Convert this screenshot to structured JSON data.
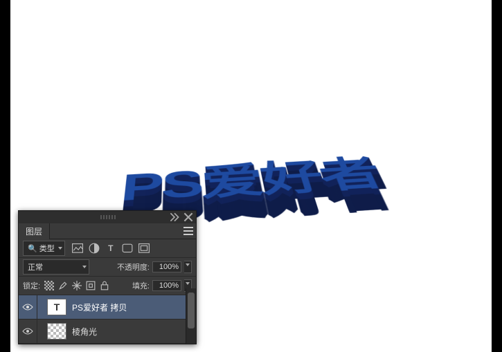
{
  "canvas": {
    "artwork_text": "PS爱好者"
  },
  "panel": {
    "tab_label": "图层",
    "filter_label": "类型",
    "filter_prefix": "🔍",
    "blend_mode": "正常",
    "opacity_label": "不透明度:",
    "opacity_value": "100%",
    "lock_label": "锁定:",
    "fill_label": "填充:",
    "fill_value": "100%",
    "filter_icons": {
      "image": "image-filter-icon",
      "adjust": "adjust-filter-icon",
      "type": "type-filter-icon",
      "shape": "shape-filter-icon",
      "smart": "smart-filter-icon"
    },
    "layers": [
      {
        "type": "T",
        "name": "PS爱好者 拷贝",
        "selected": true
      },
      {
        "type": "checker",
        "name": "棱角光",
        "selected": false
      }
    ]
  }
}
